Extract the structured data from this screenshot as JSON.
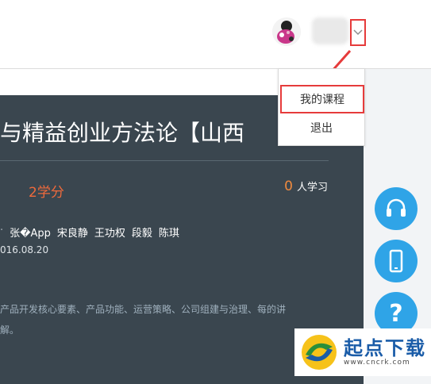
{
  "header": {
    "dropdown_icon": "chevron-down-icon"
  },
  "menu": {
    "my_courses": "我的课程",
    "logout": "退出"
  },
  "course": {
    "title": "与精益创业方法论【山西",
    "credits": "2学分",
    "learner_count": "0",
    "learner_label": "人学习",
    "teachers": [
      "张�App",
      "宋良静",
      "王功权",
      "段毅",
      "陈琪"
    ],
    "date": "016.08.20",
    "description": "产品开发核心要素、产品功能、运营策略、公司组建与治理、每的讲解。"
  },
  "side_buttons": {
    "support_icon": "headset-icon",
    "mobile_icon": "mobile-phone-icon",
    "help_icon": "question-mark-icon",
    "help_label": "?"
  },
  "watermark": {
    "title": "起点下载",
    "url": "www.cncrk.com"
  },
  "colors": {
    "banner_bg": "#3a464f",
    "accent_blue": "#2fa4e7",
    "highlight_red": "#e63b3b",
    "credit_orange": "#ef6a3c"
  }
}
